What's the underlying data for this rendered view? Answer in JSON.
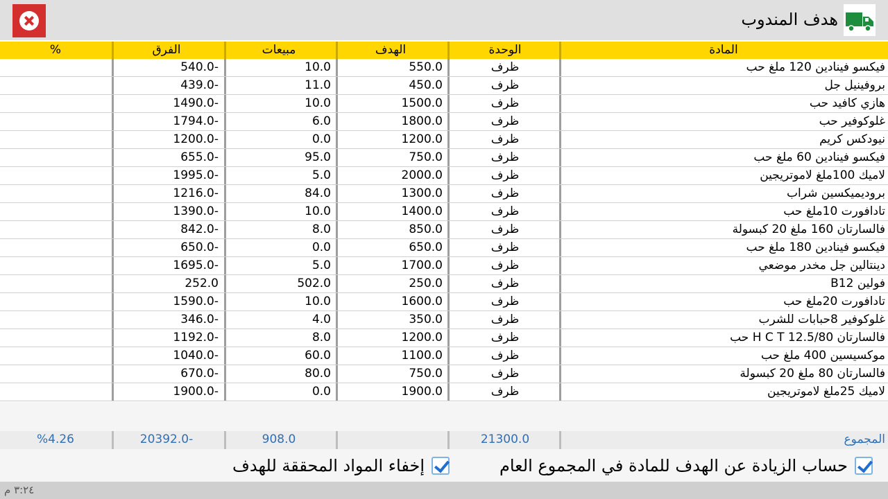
{
  "header": {
    "title": "هدف المندوب",
    "close_icon": "close-icon",
    "truck_icon": "truck-icon"
  },
  "table": {
    "columns": [
      "المادة",
      "الوحدة",
      "الهدف",
      "مبيعات",
      "الفرق",
      "%"
    ],
    "rows": [
      {
        "name": "فيكسو فينادين 120 ملغ حب",
        "unit": "ظرف",
        "target": "550.0",
        "sales": "10.0",
        "diff": "540.0-",
        "pct": ""
      },
      {
        "name": "بروفينيل جل",
        "unit": "ظرف",
        "target": "450.0",
        "sales": "11.0",
        "diff": "439.0-",
        "pct": ""
      },
      {
        "name": "هازي كافيد حب",
        "unit": "ظرف",
        "target": "1500.0",
        "sales": "10.0",
        "diff": "1490.0-",
        "pct": ""
      },
      {
        "name": "غلوكوفير حب",
        "unit": "ظرف",
        "target": "1800.0",
        "sales": "6.0",
        "diff": "1794.0-",
        "pct": ""
      },
      {
        "name": "نيودكس كريم",
        "unit": "ظرف",
        "target": "1200.0",
        "sales": "0.0",
        "diff": "1200.0-",
        "pct": ""
      },
      {
        "name": "فيكسو فينادين 60 ملغ حب",
        "unit": "ظرف",
        "target": "750.0",
        "sales": "95.0",
        "diff": "655.0-",
        "pct": ""
      },
      {
        "name": "لاميك 100ملغ لاموتريجين",
        "unit": "ظرف",
        "target": "2000.0",
        "sales": "5.0",
        "diff": "1995.0-",
        "pct": ""
      },
      {
        "name": "بروديميكسين شراب",
        "unit": "ظرف",
        "target": "1300.0",
        "sales": "84.0",
        "diff": "1216.0-",
        "pct": ""
      },
      {
        "name": "تادافورت 10ملغ حب",
        "unit": "ظرف",
        "target": "1400.0",
        "sales": "10.0",
        "diff": "1390.0-",
        "pct": ""
      },
      {
        "name": "فالسارتان 160 ملغ 20 كبسولة",
        "unit": "ظرف",
        "target": "850.0",
        "sales": "8.0",
        "diff": "842.0-",
        "pct": ""
      },
      {
        "name": "فيكسو فينادين 180 ملغ حب",
        "unit": "ظرف",
        "target": "650.0",
        "sales": "0.0",
        "diff": "650.0-",
        "pct": ""
      },
      {
        "name": "دينتالين جل مخدر موضعي",
        "unit": "ظرف",
        "target": "1700.0",
        "sales": "5.0",
        "diff": "1695.0-",
        "pct": ""
      },
      {
        "name": "فولين B12",
        "unit": "ظرف",
        "target": "250.0",
        "sales": "502.0",
        "diff": "252.0",
        "pct": ""
      },
      {
        "name": "تادافورت 20ملغ حب",
        "unit": "ظرف",
        "target": "1600.0",
        "sales": "10.0",
        "diff": "1590.0-",
        "pct": ""
      },
      {
        "name": "غلوكوفير 8حبابات للشرب",
        "unit": "ظرف",
        "target": "350.0",
        "sales": "4.0",
        "diff": "346.0-",
        "pct": ""
      },
      {
        "name": "فالسارتان H C T 12.5/80 حب",
        "unit": "ظرف",
        "target": "1200.0",
        "sales": "8.0",
        "diff": "1192.0-",
        "pct": ""
      },
      {
        "name": "موكسيسين 400 ملغ حب",
        "unit": "ظرف",
        "target": "1100.0",
        "sales": "60.0",
        "diff": "1040.0-",
        "pct": ""
      },
      {
        "name": "فالسارتان 80 ملغ 20 كبسولة",
        "unit": "ظرف",
        "target": "750.0",
        "sales": "80.0",
        "diff": "670.0-",
        "pct": ""
      },
      {
        "name": "لاميك 25ملغ لاموتريجين",
        "unit": "ظرف",
        "target": "1900.0",
        "sales": "0.0",
        "diff": "1900.0-",
        "pct": ""
      }
    ]
  },
  "totals": {
    "label": "المجموع",
    "unit": "",
    "target": "21300.0",
    "sales": "908.0",
    "diff": "20392.0-",
    "pct": "%4.26"
  },
  "options": {
    "include_excess": {
      "label": "حساب الزيادة عن الهدف للمادة في المجموع العام",
      "checked": true
    },
    "hide_achieved": {
      "label": "إخفاء المواد المحققة للهدف",
      "checked": true
    }
  },
  "status": {
    "time": "٣:٢٤ م"
  },
  "colors": {
    "header_row": "#ffd600",
    "close_button": "#d32f2f",
    "truck": "#1e8e3e",
    "totals_text": "#2e6fb6"
  }
}
